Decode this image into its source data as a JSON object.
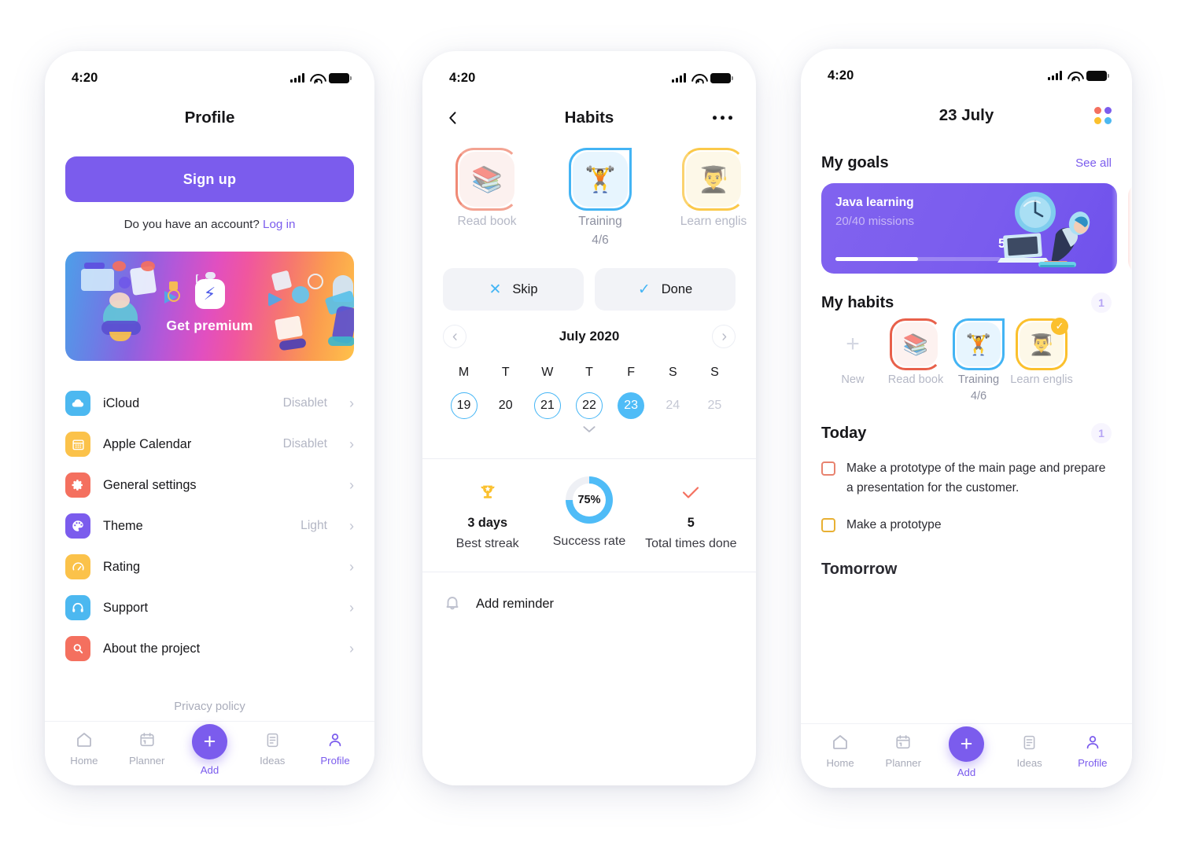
{
  "colors": {
    "purple": "#7b5ced",
    "blue": "#44b5f5",
    "coral": "#f9705f",
    "yellow": "#fbc02d",
    "text": "#17171a",
    "muted": "#b5b8c6"
  },
  "status_bar": {
    "time": "4:20",
    "signal_icon": "signal-bars-icon",
    "wifi_icon": "wifi-icon",
    "battery_icon": "battery-full-icon"
  },
  "tabbar": {
    "items": [
      {
        "label": "Home",
        "icon": "home-icon",
        "active": false
      },
      {
        "label": "Planner",
        "icon": "calendar-icon",
        "active": false
      },
      {
        "label": "Add",
        "icon": "plus-icon",
        "active": true
      },
      {
        "label": "Ideas",
        "icon": "document-icon",
        "active": false
      },
      {
        "label": "Profile",
        "icon": "person-icon",
        "active": true
      }
    ]
  },
  "profile_screen": {
    "title": "Profile",
    "signup_label": "Sign up",
    "account_question": "Do you have an account? ",
    "login_label": "Log in",
    "premium": {
      "label": "Get premium",
      "badge_icon": "lightning-bolt-icon"
    },
    "settings": [
      {
        "label": "iCloud",
        "value": "Disablet",
        "icon": "cloud-icon",
        "color": "#4cb8f0"
      },
      {
        "label": "Apple Calendar",
        "value": "Disablet",
        "icon": "calendar-icon",
        "color": "#fbc24a"
      },
      {
        "label": "General settings",
        "value": "",
        "icon": "gear-icon",
        "color": "#f4705f"
      },
      {
        "label": "Theme",
        "value": "Light",
        "icon": "palette-icon",
        "color": "#7b5ced"
      },
      {
        "label": "Rating",
        "value": "",
        "icon": "gauge-icon",
        "color": "#fbc24a"
      },
      {
        "label": "Support",
        "value": "",
        "icon": "headphones-icon",
        "color": "#4cb8f0"
      },
      {
        "label": "About the project",
        "value": "",
        "icon": "search-icon",
        "color": "#f4705f"
      }
    ],
    "privacy_label": "Privacy policy",
    "chevron": "›"
  },
  "habits_screen": {
    "title": "Habits",
    "back_icon": "chevron-left-icon",
    "more_icon": "ellipsis-icon",
    "habits": [
      {
        "name": "Read book",
        "count": "",
        "emoji": "📚",
        "ring": "#f08a76",
        "bg": "#fcf1ef",
        "current": false
      },
      {
        "name": "Training",
        "count": "4/6",
        "emoji": "🏋",
        "ring": "#43b4f4",
        "bg": "#e7f5fe",
        "current": true
      },
      {
        "name": "Learn englis",
        "count": "",
        "emoji": "👨‍🎓",
        "ring": "#fbc94a",
        "bg": "#fdf8e8",
        "current": false
      }
    ],
    "skip_label": "Skip",
    "skip_icon": "close-x-icon",
    "done_label": "Done",
    "done_icon": "check-icon",
    "calendar": {
      "month": "July 2020",
      "prev_icon": "chevron-left-icon",
      "next_icon": "chevron-right-icon",
      "expand_icon": "chevron-down-icon",
      "dow": [
        "M",
        "T",
        "W",
        "T",
        "F",
        "S",
        "S"
      ],
      "days": [
        {
          "n": "19",
          "state": "ring"
        },
        {
          "n": "20",
          "state": "plain"
        },
        {
          "n": "21",
          "state": "ring"
        },
        {
          "n": "22",
          "state": "ring"
        },
        {
          "n": "23",
          "state": "sel"
        },
        {
          "n": "24",
          "state": "dim"
        },
        {
          "n": "25",
          "state": "dim"
        }
      ]
    },
    "stats": [
      {
        "value": "3 days",
        "label": "Best streak",
        "icon": "trophy-icon"
      },
      {
        "value": "75%",
        "label": "Success rate",
        "icon": "donut-progress",
        "percent": 75
      },
      {
        "value": "5",
        "label": "Total times done",
        "icon": "check-icon"
      }
    ],
    "reminder": {
      "label": "Add reminder",
      "icon": "bell-icon"
    }
  },
  "home_screen": {
    "date_title": "23 July",
    "grid_icon": "color-dots-icon",
    "goals": {
      "title": "My goals",
      "see_all": "See all",
      "cards": [
        {
          "title": "Java learning",
          "subtitle": "20/40 missions",
          "percent": "50%",
          "progress": 50
        }
      ]
    },
    "habits": {
      "title": "My habits",
      "badge": "1",
      "new_label": "New",
      "new_icon": "plus-icon",
      "items": [
        {
          "name": "Read book",
          "count": "",
          "emoji": "📚",
          "ring": "#e8604a",
          "bg": "#fdf2f0",
          "current": false,
          "done": false
        },
        {
          "name": "Training",
          "count": "4/6",
          "emoji": "🏋",
          "ring": "#43b4f4",
          "bg": "#e7f5fe",
          "current": true,
          "done": false
        },
        {
          "name": "Learn englis",
          "count": "",
          "emoji": "👨‍🎓",
          "ring": "#fbc02d",
          "bg": "#fdf8e8",
          "current": false,
          "done": true
        }
      ]
    },
    "today": {
      "title": "Today",
      "badge": "1",
      "tasks": [
        {
          "text": "Make a prototype of the main page and prepare a presentation for the customer.",
          "color": "red"
        },
        {
          "text": "Make a prototype",
          "color": "yellow"
        }
      ]
    },
    "tomorrow": {
      "title": "Tomorrow"
    }
  }
}
